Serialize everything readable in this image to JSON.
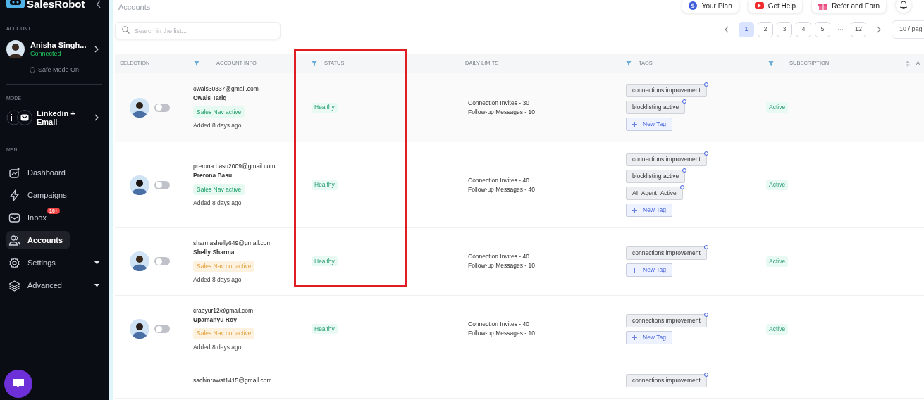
{
  "sidebar": {
    "brand": "SalesRobot",
    "account_label": "ACCOUNT",
    "account": {
      "name": "Anisha Singh...",
      "status": "Connected",
      "safe_mode": "Safe Mode On"
    },
    "mode_label": "MODE",
    "mode": "Linkedin + Email",
    "menu_label": "MENU",
    "items": [
      {
        "label": "Dashboard",
        "selected": false,
        "expandable": false
      },
      {
        "label": "Campaigns",
        "selected": false,
        "expandable": false
      },
      {
        "label": "Inbox",
        "selected": false,
        "expandable": false,
        "badge": "10+"
      },
      {
        "label": "Accounts",
        "selected": true,
        "expandable": false
      },
      {
        "label": "Settings",
        "selected": false,
        "expandable": true
      },
      {
        "label": "Advanced",
        "selected": false,
        "expandable": true
      }
    ]
  },
  "header": {
    "title": "Accounts",
    "buttons": [
      "Your Plan",
      "Get Help",
      "Refer and Earn"
    ]
  },
  "search": {
    "placeholder": "Search in the list..."
  },
  "pagination": {
    "pages": [
      {
        "label": "1",
        "selected": true
      },
      {
        "label": "2",
        "selected": false
      },
      {
        "label": "3",
        "selected": false
      },
      {
        "label": "4",
        "selected": false
      },
      {
        "label": "5",
        "selected": false
      }
    ],
    "ellipsis": "···",
    "last_page": "12",
    "page_size": "10 / pag"
  },
  "annotation": {
    "kind": "frame"
  },
  "table": {
    "columns": [
      {
        "label": "SELECTION",
        "filter": false,
        "sortable": false
      },
      {
        "label": "ACCOUNT INFO",
        "filter": true,
        "sortable": false
      },
      {
        "label": "STATUS",
        "filter": true,
        "sortable": false
      },
      {
        "label": "DAILY LIMITS",
        "filter": false,
        "sortable": false
      },
      {
        "label": "TAGS",
        "filter": true,
        "sortable": false
      },
      {
        "label": "SUBSCRIPTION",
        "filter": true,
        "sortable": true
      },
      {
        "label": "A",
        "filter": false,
        "sortable": false
      }
    ],
    "rows": [
      {
        "selected": false,
        "email": "owais30337@gmail.com",
        "name": "Owais Tariq",
        "sales_nav": {
          "text": "Sales Nav active",
          "active": true
        },
        "added": "Added 8 days ago",
        "status": "Healthy",
        "limits": [
          "Connection Invites - 30",
          "Follow-up Messages - 10"
        ],
        "tags": [
          "connections improvement",
          "blocklisting active"
        ],
        "new_tag": "New Tag",
        "subscription": "Active"
      },
      {
        "selected": false,
        "email": "prerona.basu2009@gmail.com",
        "name": "Prerona Basu",
        "sales_nav": {
          "text": "Sales Nav active",
          "active": true
        },
        "added": "Added 8 days ago",
        "status": "Healthy",
        "limits": [
          "Connection Invites - 40",
          "Follow-up Messages - 40"
        ],
        "tags": [
          "connections improvement",
          "blocklisting active",
          "AI_Agent_Active"
        ],
        "new_tag": "New Tag",
        "subscription": "Active"
      },
      {
        "selected": false,
        "email": "sharmashelly649@gmail.com",
        "name": "Shelly Sharma",
        "sales_nav": {
          "text": "Sales Nav not active",
          "active": false
        },
        "added": "Added 8 days ago",
        "status": "Healthy",
        "limits": [
          "Connection Invites - 40",
          "Follow-up Messages - 10"
        ],
        "tags": [
          "connections improvement"
        ],
        "new_tag": "New Tag",
        "subscription": "Active"
      },
      {
        "selected": false,
        "email": "crabyur12@gmail.com",
        "name": "Upamanyu Roy",
        "sales_nav": {
          "text": "Sales Nav not active",
          "active": false
        },
        "added": "Added 8 days ago",
        "status": "Healthy",
        "limits": [
          "Connection Invites - 40",
          "Follow-up Messages - 10"
        ],
        "tags": [
          "connections improvement"
        ],
        "new_tag": "New Tag",
        "subscription": "Active"
      },
      {
        "email": "sachinrawat1415@gmail.com",
        "tags": [
          "connections improvement"
        ]
      }
    ]
  }
}
